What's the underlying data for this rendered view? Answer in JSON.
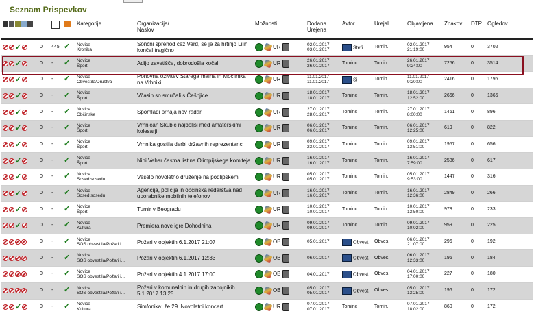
{
  "page": {
    "title": "Seznam Prispevkov"
  },
  "headers": {
    "kategorije": "Kategorije",
    "organizacija": "Organizacija/",
    "naslov": "Naslov",
    "moznosti": "Možnosti",
    "dodana": "Dodana",
    "urejena": "Urejena",
    "avtor": "Avtor",
    "urejal": "Urejal",
    "objavljena": "Objavljena",
    "znakov": "Znakov",
    "dtp": "DTP",
    "ogledov": "Ogledov"
  },
  "rows": [
    {
      "n": "0",
      "id": "445",
      "kat1": "Novice",
      "kat2": "Kronika",
      "title": "Sončni sprehod čez Verd, se je za hrtinjo Lilih končal tragično",
      "code": "UR",
      "d1": "02.01.2017",
      "d2": "03.01.2017",
      "mail": true,
      "avtor": "Stefi",
      "urejal": "Tomin.",
      "o1": "02.01.2017",
      "o2": "21:19:00",
      "znakov": "954",
      "dtp": "0",
      "ogledov": "3702",
      "ok": true
    },
    {
      "n": "0",
      "id": "-",
      "kat1": "Novice",
      "kat2": "Šport",
      "title": "Adijo zavetišče, dobrodošla kočal",
      "code": "UR",
      "d1": "26.01.2017",
      "d2": "26.01.2017",
      "mail": false,
      "avtor": "Tominc",
      "urejal": "Tomin.",
      "o1": "26.01.2017",
      "o2": "9:24:00",
      "znakov": "7256",
      "dtp": "0",
      "ogledov": "3514",
      "ok": true
    },
    {
      "n": "0",
      "id": "-",
      "kat1": "Novice",
      "kat2": "Obvestila/Društva",
      "title": "Ponovna oživitev Starega malna in Močilnika na Vrhniki",
      "code": "UR",
      "d1": "11.01.2017",
      "d2": "11.01.2017",
      "mail": true,
      "avtor": "Si",
      "urejal": "Tomin.",
      "o1": "11.01.2017",
      "o2": "9:20:00",
      "znakov": "2416",
      "dtp": "0",
      "ogledov": "1796",
      "ok": true
    },
    {
      "n": "0",
      "id": "-",
      "kat1": "Novice",
      "kat2": "Šport",
      "title": "Včasih so smučali s Češnjice",
      "code": "UR",
      "d1": "18.01.2017",
      "d2": "18.01.2017",
      "mail": false,
      "avtor": "Tominc",
      "urejal": "Tomin.",
      "o1": "18.01.2017",
      "o2": "12:52:00",
      "znakov": "2666",
      "dtp": "0",
      "ogledov": "1365",
      "ok": true
    },
    {
      "n": "0",
      "id": "-",
      "kat1": "Novice",
      "kat2": "Občinske",
      "title": "Spomladi prhaja nov radar",
      "code": "UR",
      "d1": "27.01.2017",
      "d2": "28.01.2017",
      "mail": false,
      "avtor": "Tominc",
      "urejal": "Tomin.",
      "o1": "27.01.2017",
      "o2": "8:00:00",
      "znakov": "1461",
      "dtp": "0",
      "ogledov": "896",
      "ok": true
    },
    {
      "n": "0",
      "id": "-",
      "kat1": "Novice",
      "kat2": "Šport",
      "title": "Vrhničan Skubic najboljši med amaterskimi kolesarji",
      "code": "UR",
      "d1": "06.01.2017",
      "d2": "06.01.2017",
      "mail": false,
      "avtor": "Tominc",
      "urejal": "Tomin.",
      "o1": "06.01.2017",
      "o2": "12:25:00",
      "znakov": "619",
      "dtp": "0",
      "ogledov": "822",
      "ok": true
    },
    {
      "n": "0",
      "id": "-",
      "kat1": "Novice",
      "kat2": "Šport",
      "title": "Vrhnika gostila derbi državnih reprezentanc",
      "code": "UR",
      "d1": "09.01.2017",
      "d2": "23.01.2017",
      "mail": false,
      "avtor": "Tominc",
      "urejal": "Tomin.",
      "o1": "09.01.2017",
      "o2": "13:51:00",
      "znakov": "1957",
      "dtp": "0",
      "ogledov": "656",
      "ok": true
    },
    {
      "n": "0",
      "id": "-",
      "kat1": "Novice",
      "kat2": "Šport",
      "title": "Nini Vehar častna listina Olimpijskega komiteja",
      "code": "UR",
      "d1": "16.01.2017",
      "d2": "16.01.2017",
      "mail": false,
      "avtor": "Tominc",
      "urejal": "Tomin.",
      "o1": "16.01.2017",
      "o2": "7:59:00",
      "znakov": "2586",
      "dtp": "0",
      "ogledov": "617",
      "ok": true
    },
    {
      "n": "0",
      "id": "-",
      "kat1": "Novice",
      "kat2": "Sosed sosedu",
      "title": "Veselo novoletno druženje na podlipskem",
      "code": "UR",
      "d1": "05.01.2017",
      "d2": "05.01.2017",
      "mail": false,
      "avtor": "Tominc",
      "urejal": "Tomin.",
      "o1": "05.01.2017",
      "o2": "9:53:00",
      "znakov": "1447",
      "dtp": "0",
      "ogledov": "316",
      "ok": true
    },
    {
      "n": "0",
      "id": "-",
      "kat1": "Novice",
      "kat2": "Sosed sosedu",
      "title": "Agencija, policija in občinska redarstva nad uporabnike mobilnih telefonov",
      "code": "UR",
      "d1": "16.01.2017",
      "d2": "16.01.2017",
      "mail": false,
      "avtor": "Tominc",
      "urejal": "Tomin.",
      "o1": "16.01.2017",
      "o2": "12:36:00",
      "znakov": "2849",
      "dtp": "0",
      "ogledov": "266",
      "ok": true
    },
    {
      "n": "0",
      "id": "-",
      "kat1": "Novice",
      "kat2": "Šport",
      "title": "Turnir v Beogradu",
      "code": "UR",
      "d1": "10.01.2017",
      "d2": "10.01.2017",
      "mail": false,
      "avtor": "Tominc",
      "urejal": "Tomin.",
      "o1": "10.01.2017",
      "o2": "13:50:00",
      "znakov": "978",
      "dtp": "0",
      "ogledov": "233",
      "ok": true
    },
    {
      "n": "0",
      "id": "-",
      "kat1": "Novice",
      "kat2": "Kultura",
      "title": "Premiera nove igre Dohodnina",
      "code": "UR",
      "d1": "09.01.2017",
      "d2": "09.01.2017",
      "mail": false,
      "avtor": "Tominc",
      "urejal": "Tomin.",
      "o1": "09.01.2017",
      "o2": "10:02:00",
      "znakov": "959",
      "dtp": "0",
      "ogledov": "225",
      "ok": true
    },
    {
      "n": "0",
      "id": "-",
      "kat1": "Novice",
      "kat2": "SOS obvestila/Požari i...",
      "title": "Požari v objektih 6.1.2017 21:07",
      "code": "OB",
      "d1": "05.01.2017",
      "d2": "",
      "mail": true,
      "avtor": "Obvest.",
      "urejal": "Obves.",
      "o1": "06.01.2017",
      "o2": "21:07:00",
      "znakov": "296",
      "dtp": "0",
      "ogledov": "192",
      "ok": false
    },
    {
      "n": "0",
      "id": "-",
      "kat1": "Novice",
      "kat2": "SOS obvestila/Požari i...",
      "title": "Požari v objektih 6.1.2017 12:33",
      "code": "OB",
      "d1": "06.01.2017",
      "d2": "",
      "mail": true,
      "avtor": "Obvest.",
      "urejal": "Obves.",
      "o1": "06.01.2017",
      "o2": "12:33:00",
      "znakov": "196",
      "dtp": "0",
      "ogledov": "184",
      "ok": false
    },
    {
      "n": "0",
      "id": "-",
      "kat1": "Novice",
      "kat2": "SOS obvestila/Požari i...",
      "title": "Požari v objektih 4.1.2017 17:00",
      "code": "OB",
      "d1": "04.01.2017",
      "d2": "",
      "mail": true,
      "avtor": "Obvest.",
      "urejal": "Obves.",
      "o1": "04.01.2017",
      "o2": "17:00:00",
      "znakov": "227",
      "dtp": "0",
      "ogledov": "180",
      "ok": false
    },
    {
      "n": "0",
      "id": "-",
      "kat1": "Novice",
      "kat2": "SOS obvestila/Požari i...",
      "title": "Požari v komunalnih in drugih zabojnikih 5.1.2017 13:25",
      "code": "OB",
      "d1": "05.01.2017",
      "d2": "05.01.2017",
      "mail": true,
      "avtor": "Obvest.",
      "urejal": "Obves.",
      "o1": "05.01.2017",
      "o2": "13:25:00",
      "znakov": "196",
      "dtp": "0",
      "ogledov": "172",
      "ok": false
    },
    {
      "n": "0",
      "id": "-",
      "kat1": "Novice",
      "kat2": "Kultura",
      "title": "Simfonika: že 29. Novoletni koncert",
      "code": "UR",
      "d1": "07.01.2017",
      "d2": "07.01.2017",
      "mail": false,
      "avtor": "Tominc",
      "urejal": "Tomin.",
      "o1": "07.01.2017",
      "o2": "18:02:00",
      "znakov": "860",
      "dtp": "0",
      "ogledov": "172",
      "ok": true
    }
  ]
}
